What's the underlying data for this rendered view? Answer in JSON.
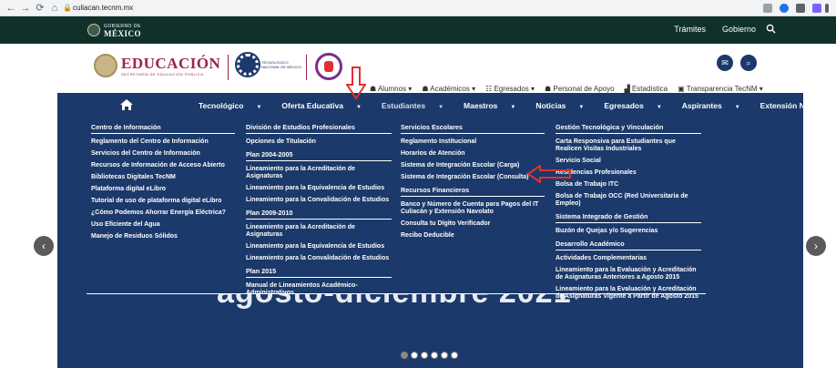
{
  "browser": {
    "url": "culiacan.tecnm.mx",
    "back": "←",
    "forward": "→",
    "reload": "⟳",
    "home": "⌂"
  },
  "gov_bar": {
    "logo_small": "GOBIERNO DE",
    "logo_big": "MÉXICO",
    "links": [
      "Trámites",
      "Gobierno"
    ]
  },
  "header": {
    "edu_title": "EDUCACIÓN",
    "edu_sub": "SECRETARÍA DE EDUCACIÓN PÚBLICA",
    "tecnm_text": "TECNOLÓGICO NACIONAL DE MÉXICO",
    "mail_icon": "✉",
    "search_icon": "⌕"
  },
  "secondary_links": [
    {
      "icon": "person-icon",
      "label": "Alumnos"
    },
    {
      "icon": "person-icon",
      "label": "Académicos"
    },
    {
      "icon": "group-icon",
      "label": "Egresados"
    },
    {
      "icon": "person-icon",
      "label": "Personal de Apoyo"
    },
    {
      "icon": "chart-icon",
      "label": "Estadística"
    },
    {
      "icon": "lock-icon",
      "label": "Transparencia TecNM"
    }
  ],
  "main_nav": [
    {
      "label": "Tecnológico",
      "dropdown": true
    },
    {
      "label": "Oferta Educativa",
      "dropdown": true
    },
    {
      "label": "Estudiantes",
      "dropdown": true
    },
    {
      "label": "Maestros",
      "dropdown": true
    },
    {
      "label": "Noticias",
      "dropdown": true
    },
    {
      "label": "Egresados",
      "dropdown": true
    },
    {
      "label": "Aspirantes",
      "dropdown": true
    },
    {
      "label": "Extensión Navolato",
      "dropdown": false
    }
  ],
  "mega_menu": {
    "col1": {
      "head": "Centro de Información",
      "items": [
        "Reglamento del Centro de Información",
        "Servicios del Centro de Información",
        "Recursos de Información de Acceso Abierto",
        "Bibliotecas Digitales TecNM",
        "Plataforma digital eLibro",
        "Tutorial de uso de plataforma digital eLibro",
        "¿Cómo Podemos Ahorrar Energía Eléctrica?",
        "Uso Eficiente del Agua",
        "Manejo de Residuos Sólidos"
      ]
    },
    "col2": {
      "head": "División de Estudios Profesionales",
      "items_a": [
        "Opciones de Titulación"
      ],
      "sub_a": "Plan 2004-2005",
      "items_b": [
        "Lineamiento para la Acreditación de Asignaturas",
        "Lineamiento para la Equivalencia de Estudios",
        "Lineamiento para la Convalidación de Estudios"
      ],
      "sub_b": "Plan 2009-2010",
      "items_c": [
        "Lineamiento para la Acreditación de Asignaturas",
        "Lineamiento para la Equivalencia de Estudios",
        "Lineamiento para la Convalidación de Estudios"
      ],
      "sub_c": "Plan 2015",
      "items_d": [
        "Manual de Lineamientos Académico-Administrativos"
      ]
    },
    "col3": {
      "head": "Servicios Escolares",
      "items_a": [
        "Reglamento Institucional",
        "Horarios de Atención",
        "Sistema de Integración Escolar (Carga)",
        "Sistema de Integración Escolar (Consulta)"
      ],
      "sub_a": "Recursos Financieros",
      "items_b": [
        "Banco y Número de Cuenta para Pagos del IT Culiacán y Extensión Navolato",
        "Consulta tu Dígito Verificador",
        "Recibo Deducible"
      ]
    },
    "col4": {
      "head": "Gestión Tecnológica y Vinculación",
      "items_a": [
        "Carta Responsiva para Estudiantes que Realicen Visitas Industriales",
        "Servicio Social",
        "Residencias Profesionales",
        "Bolsa de Trabajo ITC",
        "Bolsa de Trabajo OCC (Red Universitaria de Empleo)"
      ],
      "sub_a": "Sistema Integrado de Gestión",
      "items_b": [
        "Buzón de Quejas y/o Sugerencias"
      ],
      "sub_b": "Desarrollo Académico",
      "items_c": [
        "Actividades Complementarias",
        "Lineamiento para la Evaluación y Acreditación de Asignaturas Anteriores a Agosto 2015",
        "Lineamiento para la Evaluación y Acreditación de Asignaturas Vigente a Partir de Agosto 2015"
      ]
    }
  },
  "carousel": {
    "slide_text": "agosto-diciembre 2021",
    "prev": "‹",
    "next": "›",
    "slide_count": 6,
    "active_index": 0
  },
  "annotation_color": "#e0312f"
}
